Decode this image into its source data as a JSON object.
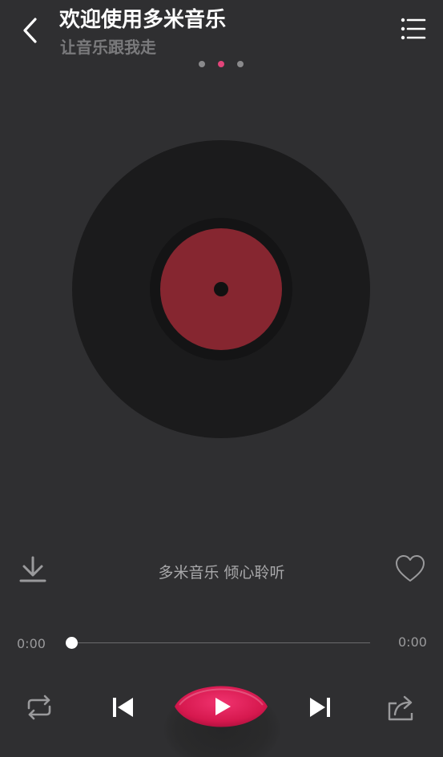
{
  "header": {
    "title": "欢迎使用多米音乐",
    "subtitle": "让音乐跟我走",
    "back_icon": "chevron-left-icon",
    "menu_icon": "list-menu-icon"
  },
  "pager": {
    "count": 3,
    "active_index": 1,
    "active_color": "#e2457a",
    "inactive_color": "#8a8a8c"
  },
  "player": {
    "song_info": "多米音乐 倾心聆听",
    "time_current": "0:00",
    "time_total": "0:00",
    "progress": 0,
    "record_label_color": "#862630"
  },
  "controls": {
    "repeat_icon": "repeat-icon",
    "prev_icon": "skip-previous-icon",
    "play_icon": "play-icon",
    "next_icon": "skip-next-icon",
    "share_icon": "share-icon",
    "download_icon": "download-icon",
    "like_icon": "heart-icon",
    "play_color": "#e01e5a"
  },
  "colors": {
    "background": "#2f2f31",
    "record": "#1b1b1c",
    "accent": "#e01e5a"
  }
}
